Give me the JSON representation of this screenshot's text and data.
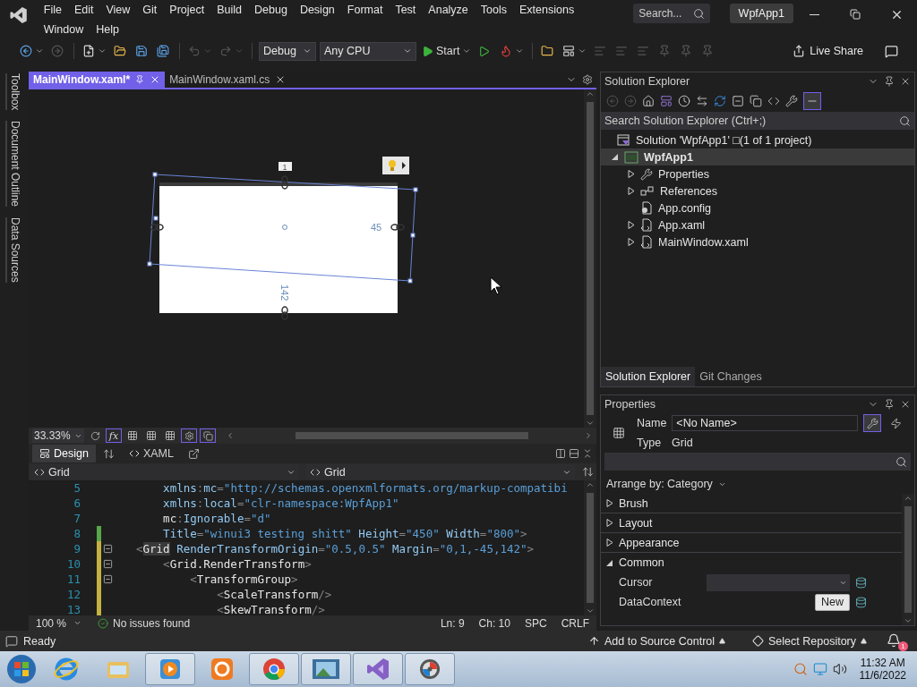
{
  "menu": [
    "File",
    "Edit",
    "View",
    "Git",
    "Project",
    "Build",
    "Debug",
    "Design",
    "Format",
    "Test",
    "Analyze",
    "Tools",
    "Extensions",
    "Window",
    "Help"
  ],
  "search": {
    "placeholder": "Search..."
  },
  "window_title": "WpfApp1",
  "toolbar": {
    "configuration": "Debug",
    "platform": "Any CPU",
    "start": "Start",
    "live_share": "Live Share"
  },
  "left_tabs": [
    "Toolbox",
    "Document Outline",
    "Data Sources"
  ],
  "editor_tabs": [
    {
      "label": "MainWindow.xaml*",
      "selected": true
    },
    {
      "label": "MainWindow.xaml.cs",
      "selected": false
    }
  ],
  "designer": {
    "margins": [
      "1",
      "45",
      "142"
    ]
  },
  "design_toolbar": {
    "zoom": "33.33%",
    "fx": "fx"
  },
  "view_tabs": [
    {
      "label": "Design",
      "selected": true
    },
    {
      "label": "XAML",
      "selected": false
    }
  ],
  "nav": [
    "Grid",
    "Grid"
  ],
  "code_lines": [
    {
      "number": "5",
      "kind": "unchanged",
      "foldable": false,
      "tokens": [
        {
          "kind": "attr",
          "text": "    xmlns"
        },
        {
          "kind": "punct",
          "text": ":"
        },
        {
          "kind": "attr",
          "text": "mc"
        },
        {
          "kind": "punct",
          "text": "="
        },
        {
          "kind": "value",
          "text": "\"http://schemas.openxmlformats.org/markup-compatibi"
        }
      ]
    },
    {
      "number": "6",
      "kind": "unchanged",
      "foldable": false,
      "tokens": [
        {
          "kind": "attr",
          "text": "    xmlns"
        },
        {
          "kind": "punct",
          "text": ":"
        },
        {
          "kind": "attr",
          "text": "local"
        },
        {
          "kind": "punct",
          "text": "="
        },
        {
          "kind": "value",
          "text": "\"clr-namespace:WpfApp1\""
        }
      ]
    },
    {
      "number": "7",
      "kind": "unchanged",
      "foldable": false,
      "tokens": [
        {
          "kind": "tag",
          "text": "    mc"
        },
        {
          "kind": "punct",
          "text": ":"
        },
        {
          "kind": "attr",
          "text": "Ignorable"
        },
        {
          "kind": "punct",
          "text": "="
        },
        {
          "kind": "value",
          "text": "\"d\""
        }
      ]
    },
    {
      "number": "8",
      "kind": "saved",
      "foldable": false,
      "tokens": [
        {
          "kind": "attr",
          "text": "    Title"
        },
        {
          "kind": "punct",
          "text": "="
        },
        {
          "kind": "value",
          "text": "\"winui3 testing shitt\""
        },
        {
          "kind": "attr",
          "text": " Height"
        },
        {
          "kind": "punct",
          "text": "="
        },
        {
          "kind": "value",
          "text": "\"450\""
        },
        {
          "kind": "attr",
          "text": " Width"
        },
        {
          "kind": "punct",
          "text": "="
        },
        {
          "kind": "value",
          "text": "\"800\""
        },
        {
          "kind": "punct",
          "text": ">"
        }
      ]
    },
    {
      "number": "9",
      "kind": "unsaved",
      "foldable": true,
      "tokens": [
        {
          "kind": "punct",
          "text": "<"
        },
        {
          "kind": "match",
          "text": "Grid"
        },
        {
          "kind": "attr",
          "text": " RenderTransformOrigin"
        },
        {
          "kind": "punct",
          "text": "="
        },
        {
          "kind": "value",
          "text": "\"0.5,0.5\""
        },
        {
          "kind": "attr",
          "text": " Margin"
        },
        {
          "kind": "punct",
          "text": "="
        },
        {
          "kind": "value",
          "text": "\"0,1,-45,142\""
        },
        {
          "kind": "punct",
          "text": ">"
        }
      ]
    },
    {
      "number": "10",
      "kind": "unsaved",
      "foldable": true,
      "tokens": [
        {
          "kind": "punct",
          "text": "    <"
        },
        {
          "kind": "tag",
          "text": "Grid.RenderTransform"
        },
        {
          "kind": "punct",
          "text": ">"
        }
      ]
    },
    {
      "number": "11",
      "kind": "unsaved",
      "foldable": true,
      "tokens": [
        {
          "kind": "punct",
          "text": "        <"
        },
        {
          "kind": "tag",
          "text": "TransformGroup"
        },
        {
          "kind": "punct",
          "text": ">"
        }
      ]
    },
    {
      "number": "12",
      "kind": "unsaved",
      "foldable": false,
      "tokens": [
        {
          "kind": "punct",
          "text": "            <"
        },
        {
          "kind": "tag",
          "text": "ScaleTransform"
        },
        {
          "kind": "punct",
          "text": "/>"
        }
      ]
    },
    {
      "number": "13",
      "kind": "unsaved",
      "foldable": false,
      "tokens": [
        {
          "kind": "punct",
          "text": "            <"
        },
        {
          "kind": "tag",
          "text": "SkewTransform"
        },
        {
          "kind": "punct",
          "text": "/>"
        }
      ]
    }
  ],
  "editor_status": {
    "zoom": "100 %",
    "issues": "No issues found",
    "line": "Ln: 9",
    "column": "Ch: 10",
    "whitespace": "SPC",
    "line_endings": "CRLF"
  },
  "solution_explorer": {
    "title": "Solution Explorer",
    "search": {
      "placeholder": "Search Solution Explorer (Ctrl+;)"
    },
    "tree": [
      {
        "label": "Solution 'WpfApp1' □(1 of 1 project)",
        "kind": "solution",
        "selected": false,
        "children": [
          {
            "label": "WpfApp1",
            "kind": "project",
            "selected": true,
            "expanded": true,
            "children": [
              {
                "label": "Properties",
                "kind": "properties",
                "selected": false,
                "expanded": false
              },
              {
                "label": "References",
                "kind": "references",
                "selected": false,
                "expanded": false
              },
              {
                "label": "App.config",
                "kind": "config",
                "selected": false
              },
              {
                "label": "App.xaml",
                "kind": "xaml",
                "selected": false,
                "expanded": false
              },
              {
                "label": "MainWindow.xaml",
                "kind": "xaml",
                "selected": false,
                "expanded": false
              }
            ]
          }
        ]
      }
    ],
    "tabs": [
      {
        "label": "Solution Explorer",
        "selected": true
      },
      {
        "label": "Git Changes",
        "selected": false
      }
    ]
  },
  "properties": {
    "title": "Properties",
    "name_label": "Name",
    "name_value": "<No Name>",
    "type_label": "Type",
    "type_value": "Grid",
    "arrange_by": "Arrange by: Category",
    "categories": [
      {
        "label": "Brush",
        "expanded": false
      },
      {
        "label": "Layout",
        "expanded": false
      },
      {
        "label": "Appearance",
        "expanded": false
      },
      {
        "label": "Common",
        "expanded": true,
        "properties": [
          {
            "label": "Cursor",
            "kind": "dropdown"
          },
          {
            "label": "DataContext",
            "kind": "button",
            "button": "New"
          }
        ]
      }
    ]
  },
  "status_bar": {
    "message": "Ready",
    "source_control": "Add to Source Control",
    "repository": "Select Repository",
    "notifications": "1"
  },
  "taskbar": {
    "apps": [
      {
        "kind": "browser",
        "running": false
      },
      {
        "kind": "folder",
        "running": false
      },
      {
        "kind": "media",
        "running": true
      },
      {
        "kind": "squirrel",
        "running": false
      },
      {
        "kind": "chrome",
        "running": true
      },
      {
        "kind": "photos",
        "running": true
      },
      {
        "kind": "studio",
        "running": true
      },
      {
        "kind": "disc",
        "running": true
      }
    ],
    "time": "11:32 AM",
    "date": "11/6/2022"
  }
}
